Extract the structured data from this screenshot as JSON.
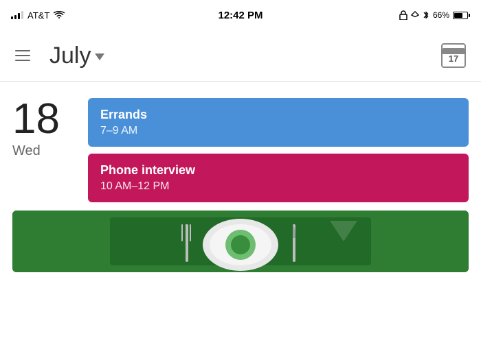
{
  "status_bar": {
    "carrier": "AT&T",
    "time": "12:42 PM",
    "battery_pct": "66%"
  },
  "app_bar": {
    "month": "July",
    "dropdown_label": "month dropdown",
    "calendar_day": "17"
  },
  "day_view": {
    "day_number": "18",
    "day_name": "Wed"
  },
  "events": [
    {
      "id": "errands",
      "title": "Errands",
      "time": "7–9 AM",
      "color": "blue"
    },
    {
      "id": "phone-interview",
      "title": "Phone interview",
      "time": "10 AM–12 PM",
      "color": "pink"
    }
  ],
  "image_event": {
    "description": "Lunch with restaurant event",
    "bg_color": "#2E7D32"
  }
}
